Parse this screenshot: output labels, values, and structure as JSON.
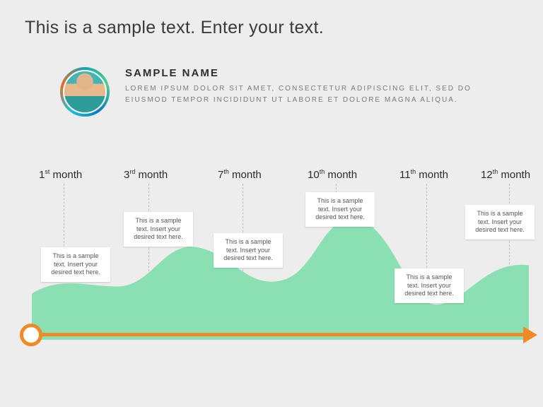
{
  "title": "This is a sample text. Enter your text.",
  "profile": {
    "name": "SAMPLE NAME",
    "desc": "LOREM IPSUM DOLOR SIT AMET, CONSECTETUR ADIPISCING ELIT, SED DO EIUSMOD TEMPOR INCIDIDUNT UT LABORE ET DOLORE MAGNA ALIQUA."
  },
  "timeline": {
    "labels": [
      {
        "ord_num": "1",
        "ord_suf": "st",
        "word": " month"
      },
      {
        "ord_num": "3",
        "ord_suf": "rd",
        "word": " month"
      },
      {
        "ord_num": "7",
        "ord_suf": "th",
        "word": " month"
      },
      {
        "ord_num": "10",
        "ord_suf": "th",
        "word": " month"
      },
      {
        "ord_num": "11",
        "ord_suf": "th",
        "word": " month"
      },
      {
        "ord_num": "12",
        "ord_suf": "th",
        "word": " month"
      }
    ],
    "box_text": "This is a sample text.  Insert your desired text here."
  },
  "colors": {
    "wave": "#8be0b3",
    "axis": "#f08a24"
  },
  "chart_data": {
    "type": "area",
    "title": "",
    "xlabel": "month",
    "ylabel": "",
    "categories": [
      "1st month",
      "3rd month",
      "7th month",
      "10th month",
      "11th month",
      "12th month"
    ],
    "values": [
      65,
      85,
      70,
      110,
      50,
      95
    ],
    "ylim": [
      0,
      140
    ],
    "note": "values are approximate relative heights read from the unscaled wave shape"
  }
}
